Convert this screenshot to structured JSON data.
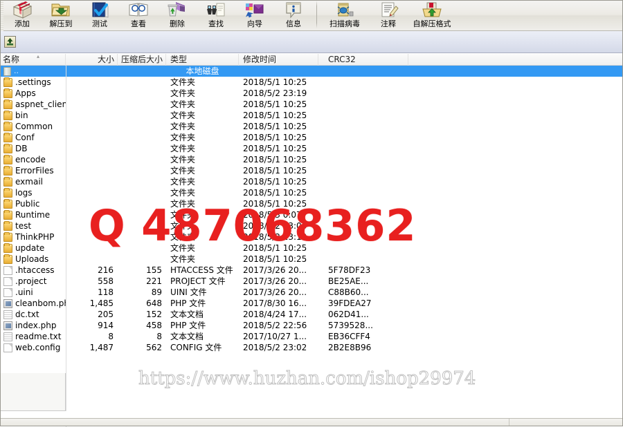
{
  "toolbar": {
    "buttons": [
      {
        "label": "添加",
        "icon": "add-archive-icon"
      },
      {
        "label": "解压到",
        "icon": "extract-to-icon"
      },
      {
        "label": "测试",
        "icon": "test-archive-icon"
      },
      {
        "label": "查看",
        "icon": "view-file-icon"
      },
      {
        "label": "删除",
        "icon": "delete-icon"
      },
      {
        "label": "查找",
        "icon": "find-icon"
      },
      {
        "label": "向导",
        "icon": "wizard-icon"
      },
      {
        "label": "信息",
        "icon": "info-icon"
      }
    ],
    "buttons_right": [
      {
        "label": "扫描病毒",
        "icon": "virus-scan-icon"
      },
      {
        "label": "注释",
        "icon": "comment-icon"
      },
      {
        "label": "自解压格式",
        "icon": "sfx-icon"
      }
    ]
  },
  "addressbar": {
    "up_icon": "up-one-level-icon"
  },
  "columns": [
    {
      "key": "name",
      "label": "名称",
      "align": "left"
    },
    {
      "key": "size",
      "label": "大小",
      "align": "right"
    },
    {
      "key": "pack",
      "label": "压缩后大小",
      "align": "right"
    },
    {
      "key": "type",
      "label": "类型",
      "align": "left"
    },
    {
      "key": "time",
      "label": "修改时间",
      "align": "left"
    },
    {
      "key": "crc",
      "label": "CRC32",
      "align": "left"
    }
  ],
  "rows": [
    {
      "name": "..",
      "icon": "drive-icon",
      "size": "",
      "pack": "",
      "type": "本地磁盘",
      "time": "",
      "crc": "",
      "selected": true
    },
    {
      "name": ".settings",
      "icon": "folder-icon",
      "size": "",
      "pack": "",
      "type": "文件夹",
      "time": "2018/5/1 10:25",
      "crc": ""
    },
    {
      "name": "Apps",
      "icon": "folder-icon",
      "size": "",
      "pack": "",
      "type": "文件夹",
      "time": "2018/5/2 23:19",
      "crc": ""
    },
    {
      "name": "aspnet_client",
      "icon": "folder-icon",
      "size": "",
      "pack": "",
      "type": "文件夹",
      "time": "2018/5/1 10:25",
      "crc": ""
    },
    {
      "name": "bin",
      "icon": "folder-icon",
      "size": "",
      "pack": "",
      "type": "文件夹",
      "time": "2018/5/1 10:25",
      "crc": ""
    },
    {
      "name": "Common",
      "icon": "folder-icon",
      "size": "",
      "pack": "",
      "type": "文件夹",
      "time": "2018/5/1 10:25",
      "crc": ""
    },
    {
      "name": "Conf",
      "icon": "folder-icon",
      "size": "",
      "pack": "",
      "type": "文件夹",
      "time": "2018/5/1 10:25",
      "crc": ""
    },
    {
      "name": "DB",
      "icon": "folder-icon",
      "size": "",
      "pack": "",
      "type": "文件夹",
      "time": "2018/5/1 10:25",
      "crc": ""
    },
    {
      "name": "encode",
      "icon": "folder-icon",
      "size": "",
      "pack": "",
      "type": "文件夹",
      "time": "2018/5/1 10:25",
      "crc": ""
    },
    {
      "name": "ErrorFiles",
      "icon": "folder-icon",
      "size": "",
      "pack": "",
      "type": "文件夹",
      "time": "2018/5/1 10:25",
      "crc": ""
    },
    {
      "name": "exmail",
      "icon": "folder-icon",
      "size": "",
      "pack": "",
      "type": "文件夹",
      "time": "2018/5/1 10:25",
      "crc": ""
    },
    {
      "name": "logs",
      "icon": "folder-icon",
      "size": "",
      "pack": "",
      "type": "文件夹",
      "time": "2018/5/1 10:25",
      "crc": ""
    },
    {
      "name": "Public",
      "icon": "folder-icon",
      "size": "",
      "pack": "",
      "type": "文件夹",
      "time": "2018/5/1 10:25",
      "crc": ""
    },
    {
      "name": "Runtime",
      "icon": "folder-icon",
      "size": "",
      "pack": "",
      "type": "文件夹",
      "time": "2018/5/3 0:07",
      "crc": ""
    },
    {
      "name": "test",
      "icon": "folder-icon",
      "size": "",
      "pack": "",
      "type": "文件夹",
      "time": "2018/5/2 23:06",
      "crc": ""
    },
    {
      "name": "ThinkPHP",
      "icon": "folder-icon",
      "size": "",
      "pack": "",
      "type": "文件夹",
      "time": "2018/5/2 23:19",
      "crc": ""
    },
    {
      "name": "update",
      "icon": "folder-icon",
      "size": "",
      "pack": "",
      "type": "文件夹",
      "time": "2018/5/1 10:25",
      "crc": ""
    },
    {
      "name": "Uploads",
      "icon": "folder-icon",
      "size": "",
      "pack": "",
      "type": "文件夹",
      "time": "2018/5/1 10:25",
      "crc": ""
    },
    {
      "name": ".htaccess",
      "icon": "file-icon",
      "size": "216",
      "pack": "155",
      "type": "HTACCESS 文件",
      "time": "2017/3/26 20...",
      "crc": "5F78DF23"
    },
    {
      "name": ".project",
      "icon": "file-icon",
      "size": "558",
      "pack": "221",
      "type": "PROJECT 文件",
      "time": "2017/3/26 20...",
      "crc": "BE25AE..."
    },
    {
      "name": ".uini",
      "icon": "file-icon",
      "size": "118",
      "pack": "89",
      "type": "UINI 文件",
      "time": "2017/3/26 20...",
      "crc": "C88B60..."
    },
    {
      "name": "cleanbom.php",
      "icon": "php-icon",
      "size": "1,485",
      "pack": "648",
      "type": "PHP 文件",
      "time": "2017/8/30 16...",
      "crc": "39FDEA27"
    },
    {
      "name": "dc.txt",
      "icon": "text-icon",
      "size": "205",
      "pack": "152",
      "type": "文本文档",
      "time": "2018/4/24 17...",
      "crc": "062D41..."
    },
    {
      "name": "index.php",
      "icon": "php-icon",
      "size": "914",
      "pack": "458",
      "type": "PHP 文件",
      "time": "2018/5/2 22:56",
      "crc": "5739528..."
    },
    {
      "name": "readme.txt",
      "icon": "text-icon",
      "size": "8",
      "pack": "8",
      "type": "文本文档",
      "time": "2017/10/27 1...",
      "crc": "EB36CFF4"
    },
    {
      "name": "web.config",
      "icon": "file-icon",
      "size": "1,487",
      "pack": "562",
      "type": "CONFIG 文件",
      "time": "2018/5/2 23:02",
      "crc": "2B2E8B96"
    }
  ],
  "watermarks": {
    "qq": "Q 487068362",
    "qq_color": "#e8201f",
    "url": "https://www.huzhan.com/ishop29974"
  },
  "statusbar": {
    "text": ""
  }
}
